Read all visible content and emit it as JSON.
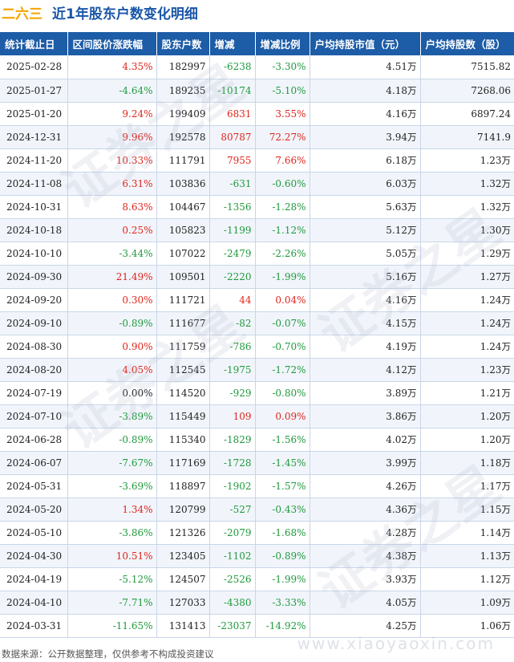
{
  "header": {
    "stock_name": "二六三",
    "title": "近1年股东户数变化明细"
  },
  "table": {
    "columns": [
      "统计截止日",
      "区间股价涨跌幅",
      "股东户数",
      "增减",
      "增减比例",
      "户均持股市值（元）",
      "户均持股数（股）"
    ],
    "rows": [
      [
        "2025-02-28",
        "4.35%",
        "182997",
        "-6238",
        "-3.30%",
        "4.51",
        "7515.82"
      ],
      [
        "2025-01-27",
        "-4.64%",
        "189235",
        "-10174",
        "-5.10%",
        "4.18",
        "7268.06"
      ],
      [
        "2025-01-20",
        "9.24%",
        "199409",
        "6831",
        "3.55%",
        "4.16",
        "6897.24"
      ],
      [
        "2024-12-31",
        "9.96%",
        "192578",
        "80787",
        "72.27%",
        "3.94",
        "7141.9"
      ],
      [
        "2024-11-20",
        "10.33%",
        "111791",
        "7955",
        "7.66%",
        "6.18",
        "1.23"
      ],
      [
        "2024-11-08",
        "6.31%",
        "103836",
        "-631",
        "-0.60%",
        "6.03",
        "1.32"
      ],
      [
        "2024-10-31",
        "8.63%",
        "104467",
        "-1356",
        "-1.28%",
        "5.63",
        "1.32"
      ],
      [
        "2024-10-18",
        "0.25%",
        "105823",
        "-1199",
        "-1.12%",
        "5.12",
        "1.30"
      ],
      [
        "2024-10-10",
        "-3.44%",
        "107022",
        "-2479",
        "-2.26%",
        "5.05",
        "1.29"
      ],
      [
        "2024-09-30",
        "21.49%",
        "109501",
        "-2220",
        "-1.99%",
        "5.16",
        "1.27"
      ],
      [
        "2024-09-20",
        "0.30%",
        "111721",
        "44",
        "0.04%",
        "4.16",
        "1.24"
      ],
      [
        "2024-09-10",
        "-0.89%",
        "111677",
        "-82",
        "-0.07%",
        "4.15",
        "1.24"
      ],
      [
        "2024-08-30",
        "0.90%",
        "111759",
        "-786",
        "-0.70%",
        "4.19",
        "1.24"
      ],
      [
        "2024-08-20",
        "4.05%",
        "112545",
        "-1975",
        "-1.72%",
        "4.12",
        "1.23"
      ],
      [
        "2024-07-19",
        "0.00%",
        "114520",
        "-929",
        "-0.80%",
        "3.89",
        "1.21"
      ],
      [
        "2024-07-10",
        "-3.89%",
        "115449",
        "109",
        "0.09%",
        "3.86",
        "1.20"
      ],
      [
        "2024-06-28",
        "-0.89%",
        "115340",
        "-1829",
        "-1.56%",
        "4.02",
        "1.20"
      ],
      [
        "2024-06-07",
        "-7.67%",
        "117169",
        "-1728",
        "-1.45%",
        "3.99",
        "1.18"
      ],
      [
        "2024-05-31",
        "-3.69%",
        "118897",
        "-1902",
        "-1.57%",
        "4.26",
        "1.17"
      ],
      [
        "2024-05-20",
        "1.34%",
        "120799",
        "-527",
        "-0.43%",
        "4.36",
        "1.15"
      ],
      [
        "2024-05-10",
        "-3.86%",
        "121326",
        "-2079",
        "-1.68%",
        "4.28",
        "1.14"
      ],
      [
        "2024-04-30",
        "10.51%",
        "123405",
        "-1102",
        "-0.89%",
        "4.38",
        "1.13"
      ],
      [
        "2024-04-19",
        "-5.12%",
        "124507",
        "-2526",
        "-1.99%",
        "3.93",
        "1.12"
      ],
      [
        "2024-04-10",
        "-7.71%",
        "127033",
        "-4380",
        "-3.33%",
        "4.05",
        "1.09"
      ],
      [
        "2024-03-31",
        "-11.65%",
        "131413",
        "-23037",
        "-14.92%",
        "4.25",
        "1.06"
      ]
    ],
    "avg_shares_wan_flags": [
      false,
      false,
      false,
      false,
      true,
      true,
      true,
      true,
      true,
      true,
      true,
      true,
      true,
      true,
      true,
      true,
      true,
      true,
      true,
      true,
      true,
      true,
      true,
      true,
      true
    ],
    "wan_unit": "万"
  },
  "footer": {
    "source_text": "数据来源：公开数据整理，仅供参考不构成投资建议"
  },
  "watermark": {
    "url": "www.xiaoyaoxin.com"
  },
  "colors": {
    "header_bg": "#1d5ca6",
    "up": "#e0241b",
    "down": "#1f9a3c",
    "name": "#f5a300",
    "title": "#1a56a8"
  }
}
